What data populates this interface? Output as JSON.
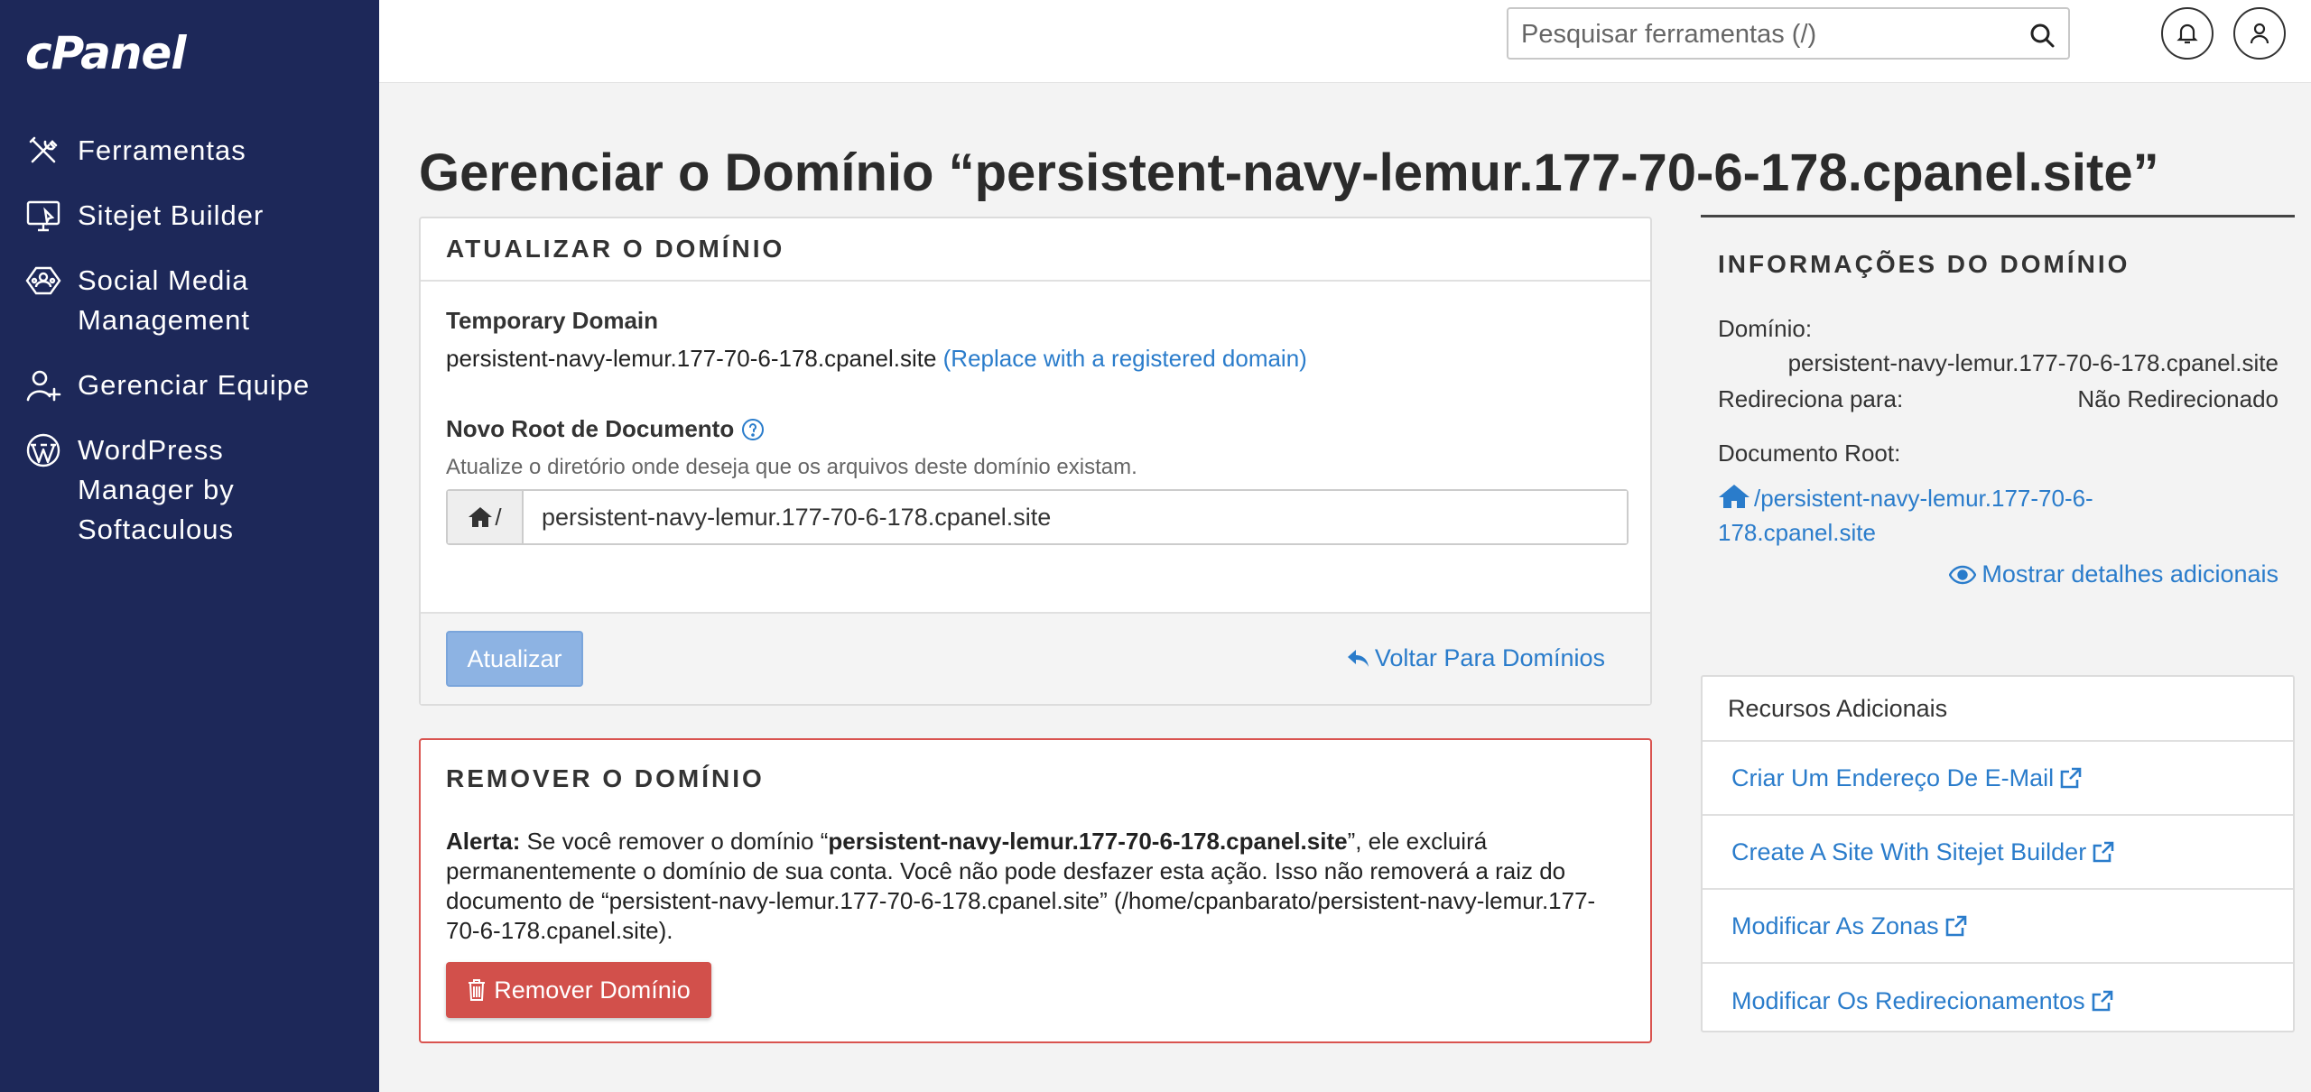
{
  "sidebar": {
    "logo": "cPanel",
    "items": [
      {
        "label": "Ferramentas",
        "icon": "tools-icon"
      },
      {
        "label": "Sitejet Builder",
        "icon": "monitor-icon"
      },
      {
        "label": "Social Media Management",
        "icon": "social-media-icon"
      },
      {
        "label": "Gerenciar Equipe",
        "icon": "user-plus-icon"
      },
      {
        "label": "WordPress Manager by Softaculous",
        "icon": "wordpress-icon"
      }
    ]
  },
  "topbar": {
    "search_placeholder": "Pesquisar ferramentas (/)"
  },
  "page": {
    "title": "Gerenciar o Domínio “persistent-navy-lemur.177-70-6-178.cpanel.site”"
  },
  "update_panel": {
    "heading": "ATUALIZAR O DOMÍNIO",
    "temp_label": "Temporary Domain",
    "temp_value": "persistent-navy-lemur.177-70-6-178.cpanel.site",
    "replace_link": "(Replace with a registered domain)",
    "root_label": "Novo Root de Documento",
    "root_help": "Atualize o diretório onde deseja que os arquivos deste domínio existam.",
    "root_prefix": "/",
    "root_value": "persistent-navy-lemur.177-70-6-178.cpanel.site",
    "update_button": "Atualizar",
    "back_link": "Voltar Para Domínios"
  },
  "remove_panel": {
    "heading": "REMOVER O DOMÍNIO",
    "alert_label": "Alerta:",
    "alert_pre": " Se você remover o domínio “",
    "alert_domain": "persistent-navy-lemur.177-70-6-178.cpanel.site",
    "alert_post": "”, ele excluirá permanentemente o domínio de sua conta. Você não pode desfazer esta ação. Isso não removerá a raiz do documento de “persistent-navy-lemur.177-70-6-178.cpanel.site” (/home/cpanbarato/persistent-navy-lemur.177-70-6-178.cpanel.site).",
    "remove_button": "Remover Domínio"
  },
  "info": {
    "heading": "INFORMAÇÕES DO DOMÍNIO",
    "domain_label": "Domínio:",
    "domain_value": "persistent-navy-lemur.177-70-6-178.cpanel.site",
    "redirect_label": "Redireciona para:",
    "redirect_value": "Não Redirecionado",
    "root_label": "Documento Root:",
    "root_link": "/persistent-navy-lemur.177-70-6-178.cpanel.site",
    "details_link": "Mostrar detalhes adicionais"
  },
  "resources": {
    "heading": "Recursos Adicionais",
    "items": [
      "Criar Um Endereço De E-Mail",
      "Create A Site With Sitejet Builder",
      "Modificar As Zonas",
      "Modificar Os Redirecionamentos"
    ]
  },
  "colors": {
    "sidebar_bg": "#1d2859",
    "link": "#2a7ccb",
    "danger": "#d2504b",
    "primary_disabled": "#8db3e3"
  }
}
